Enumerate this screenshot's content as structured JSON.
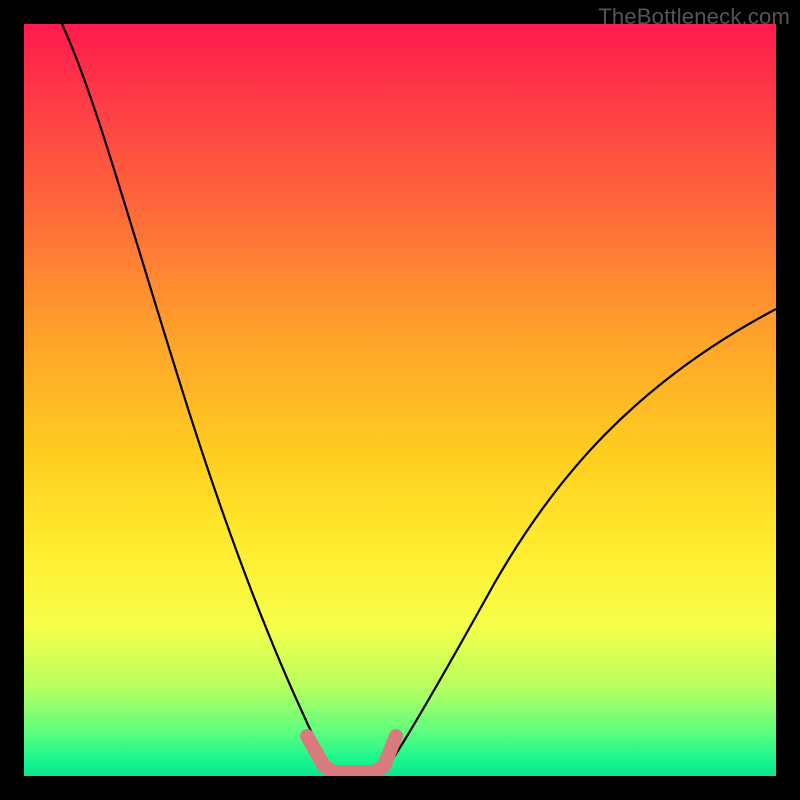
{
  "watermark": {
    "text": "TheBottleneck.com"
  },
  "chart_data": {
    "type": "line",
    "title": "",
    "xlabel": "",
    "ylabel": "",
    "xlim": [
      0,
      100
    ],
    "ylim": [
      0,
      100
    ],
    "grid": false,
    "legend": false,
    "background_gradient_stops": [
      {
        "pos": 0,
        "color": "#ff1a4d"
      },
      {
        "pos": 25,
        "color": "#ff6a3a"
      },
      {
        "pos": 58,
        "color": "#ffcf1f"
      },
      {
        "pos": 80,
        "color": "#f6ff4a"
      },
      {
        "pos": 94,
        "color": "#5fff7e"
      },
      {
        "pos": 100,
        "color": "#0ee58f"
      }
    ],
    "series": [
      {
        "name": "left-curve",
        "color": "#000000",
        "x": [
          5,
          8,
          12,
          16,
          20,
          24,
          28,
          31,
          34,
          36,
          38,
          40
        ],
        "values": [
          100,
          87,
          73,
          60,
          48,
          36,
          25,
          16,
          9,
          5,
          2,
          0
        ]
      },
      {
        "name": "right-curve",
        "color": "#000000",
        "x": [
          48,
          52,
          56,
          62,
          68,
          74,
          80,
          86,
          92,
          100
        ],
        "values": [
          0,
          5,
          10,
          18,
          26,
          33,
          40,
          47,
          53,
          61
        ]
      },
      {
        "name": "highlight-segment",
        "color": "#d97a7e",
        "stroke_width": 14,
        "x": [
          37,
          39,
          40,
          44,
          47,
          48,
          49
        ],
        "values": [
          5,
          2,
          0,
          0,
          0,
          2,
          5
        ]
      },
      {
        "name": "baseline",
        "color": "#0ee58f",
        "x": [
          0,
          100
        ],
        "values": [
          0,
          0
        ]
      }
    ],
    "notes": "Values read off the plot by estimation; y expressed as percent of plot height from bottom (0 = bottom edge, 100 = top edge). No axes, ticks, or labels are rendered in the image."
  }
}
